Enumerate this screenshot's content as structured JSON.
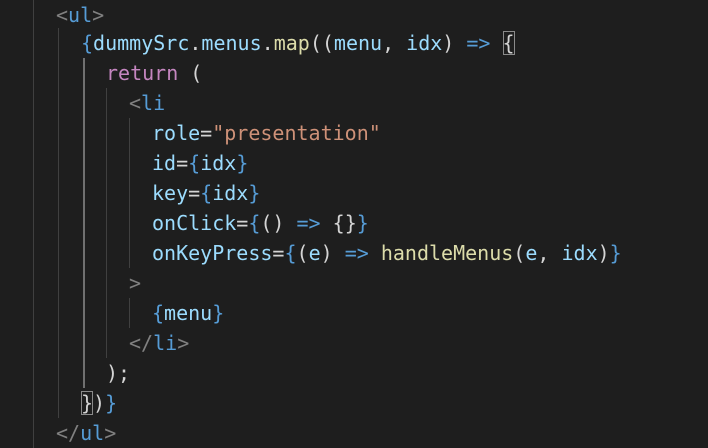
{
  "colors": {
    "background": "#1e1e1e",
    "tag": "#808080",
    "tagName": "#569cd6",
    "brace": "#569cd6",
    "identifier": "#9cdcfe",
    "function": "#dcdcaa",
    "punctuation": "#d4d4d4",
    "keyword": "#c586c0",
    "string": "#ce9178",
    "guide": "#404040",
    "guideActive": "#707070"
  },
  "code": {
    "lines": [
      {
        "tokens": [
          {
            "text": "<",
            "color": "tag"
          },
          {
            "text": "ul",
            "color": "tagName"
          },
          {
            "text": ">",
            "color": "tag"
          }
        ]
      },
      {
        "tokens": [
          {
            "text": "{",
            "color": "brace"
          },
          {
            "text": "dummySrc",
            "color": "identifier"
          },
          {
            "text": ".",
            "color": "punctuation"
          },
          {
            "text": "menus",
            "color": "identifier"
          },
          {
            "text": ".",
            "color": "punctuation"
          },
          {
            "text": "map",
            "color": "function"
          },
          {
            "text": "((",
            "color": "punctuation"
          },
          {
            "text": "menu",
            "color": "identifier"
          },
          {
            "text": ", ",
            "color": "punctuation"
          },
          {
            "text": "idx",
            "color": "identifier"
          },
          {
            "text": ") ",
            "color": "punctuation"
          },
          {
            "text": "=>",
            "color": "brace"
          },
          {
            "text": " ",
            "color": "punctuation"
          },
          {
            "text": "{",
            "color": "punctuation",
            "cursor": true
          }
        ]
      },
      {
        "tokens": [
          {
            "text": "return",
            "color": "keyword"
          },
          {
            "text": " (",
            "color": "punctuation"
          }
        ]
      },
      {
        "tokens": [
          {
            "text": "<",
            "color": "tag"
          },
          {
            "text": "li",
            "color": "tagName"
          }
        ]
      },
      {
        "tokens": [
          {
            "text": "role",
            "color": "identifier"
          },
          {
            "text": "=",
            "color": "punctuation"
          },
          {
            "text": "\"presentation\"",
            "color": "string"
          }
        ]
      },
      {
        "tokens": [
          {
            "text": "id",
            "color": "identifier"
          },
          {
            "text": "=",
            "color": "punctuation"
          },
          {
            "text": "{",
            "color": "brace"
          },
          {
            "text": "idx",
            "color": "identifier"
          },
          {
            "text": "}",
            "color": "brace"
          }
        ]
      },
      {
        "tokens": [
          {
            "text": "key",
            "color": "identifier"
          },
          {
            "text": "=",
            "color": "punctuation"
          },
          {
            "text": "{",
            "color": "brace"
          },
          {
            "text": "idx",
            "color": "identifier"
          },
          {
            "text": "}",
            "color": "brace"
          }
        ]
      },
      {
        "tokens": [
          {
            "text": "onClick",
            "color": "identifier"
          },
          {
            "text": "=",
            "color": "punctuation"
          },
          {
            "text": "{",
            "color": "brace"
          },
          {
            "text": "() ",
            "color": "punctuation"
          },
          {
            "text": "=>",
            "color": "brace"
          },
          {
            "text": " {}",
            "color": "punctuation"
          },
          {
            "text": "}",
            "color": "brace"
          }
        ]
      },
      {
        "tokens": [
          {
            "text": "onKeyPress",
            "color": "identifier"
          },
          {
            "text": "=",
            "color": "punctuation"
          },
          {
            "text": "{",
            "color": "brace"
          },
          {
            "text": "(",
            "color": "punctuation"
          },
          {
            "text": "e",
            "color": "identifier"
          },
          {
            "text": ") ",
            "color": "punctuation"
          },
          {
            "text": "=>",
            "color": "brace"
          },
          {
            "text": " ",
            "color": "punctuation"
          },
          {
            "text": "handleMenus",
            "color": "function"
          },
          {
            "text": "(",
            "color": "punctuation"
          },
          {
            "text": "e",
            "color": "identifier"
          },
          {
            "text": ", ",
            "color": "punctuation"
          },
          {
            "text": "idx",
            "color": "identifier"
          },
          {
            "text": ")",
            "color": "punctuation"
          },
          {
            "text": "}",
            "color": "brace"
          }
        ]
      },
      {
        "tokens": [
          {
            "text": ">",
            "color": "tag"
          }
        ]
      },
      {
        "tokens": [
          {
            "text": "{",
            "color": "brace"
          },
          {
            "text": "menu",
            "color": "identifier"
          },
          {
            "text": "}",
            "color": "brace"
          }
        ]
      },
      {
        "tokens": [
          {
            "text": "</",
            "color": "tag"
          },
          {
            "text": "li",
            "color": "tagName"
          },
          {
            "text": ">",
            "color": "tag"
          }
        ]
      },
      {
        "tokens": [
          {
            "text": ");",
            "color": "punctuation"
          }
        ]
      },
      {
        "tokens": [
          {
            "text": "}",
            "color": "punctuation",
            "cursor": true
          },
          {
            "text": ")",
            "color": "punctuation"
          },
          {
            "text": "}",
            "color": "brace"
          }
        ]
      },
      {
        "tokens": [
          {
            "text": "</",
            "color": "tag"
          },
          {
            "text": "ul",
            "color": "tagName"
          },
          {
            "text": ">",
            "color": "tag"
          }
        ]
      }
    ]
  }
}
